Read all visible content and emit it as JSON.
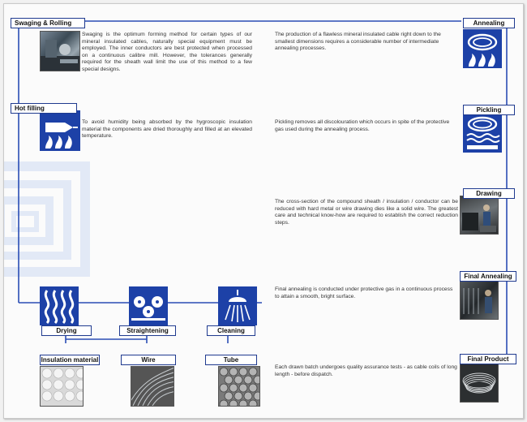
{
  "colors": {
    "accent": "#1d41a7",
    "line": "#2a4db5",
    "watermark": "#dfe7f5"
  },
  "left_steps": [
    {
      "key": "swaging",
      "label": "Swaging & Rolling",
      "text": "Swaging is the optimum forming method for certain types of our mineral insulated cables, naturally special equipment must be employed. The inner conductors are best protected when processed on a continuous calibre mill. However, the tolerances generally required for the sheath wall limit the use of this method to a few special designs."
    },
    {
      "key": "hot_filling",
      "label": "Hot filling",
      "icon": "nozzle-flame-icon",
      "text": "To avoid humidity being absorbed by the hygroscopic insulation material the components are dried thoroughly and filled at an elevated temperature."
    }
  ],
  "bottom_steps": [
    {
      "label": "Drying",
      "icon": "heat-waves-icon"
    },
    {
      "label": "Straightening",
      "icon": "rollers-icon"
    },
    {
      "label": "Cleaning",
      "icon": "shower-icon"
    }
  ],
  "materials": [
    {
      "label": "Insulation material"
    },
    {
      "label": "Wire"
    },
    {
      "label": "Tube"
    }
  ],
  "right_steps": [
    {
      "label": "Annealing",
      "icon": "coil-flame-icon",
      "text": "The production of a flawless mineral insulated cable right down to the smallest dimensions requires a considerable number of intermediate annealing processes."
    },
    {
      "label": "Pickling",
      "icon": "coil-bath-icon",
      "text": "Pickling removes all discolouration which occurs in spite of the protective gas used during the annealing process."
    },
    {
      "label": "Drawing",
      "text": "The cross-section of the compound sheath / insulation / conductor can be reduced with hard metal or wire drawing dies like a solid wire. The greatest care and technical know-how are required to establish the correct reduction steps."
    },
    {
      "label": "Final Annealing",
      "text": "Final annealing is conducted under protective gas in a continuous process to attain a smooth, bright surface."
    },
    {
      "label": "Final Product",
      "text": "Each drawn batch undergoes quality assurance tests - as cable coils of long length - before dispatch."
    }
  ]
}
